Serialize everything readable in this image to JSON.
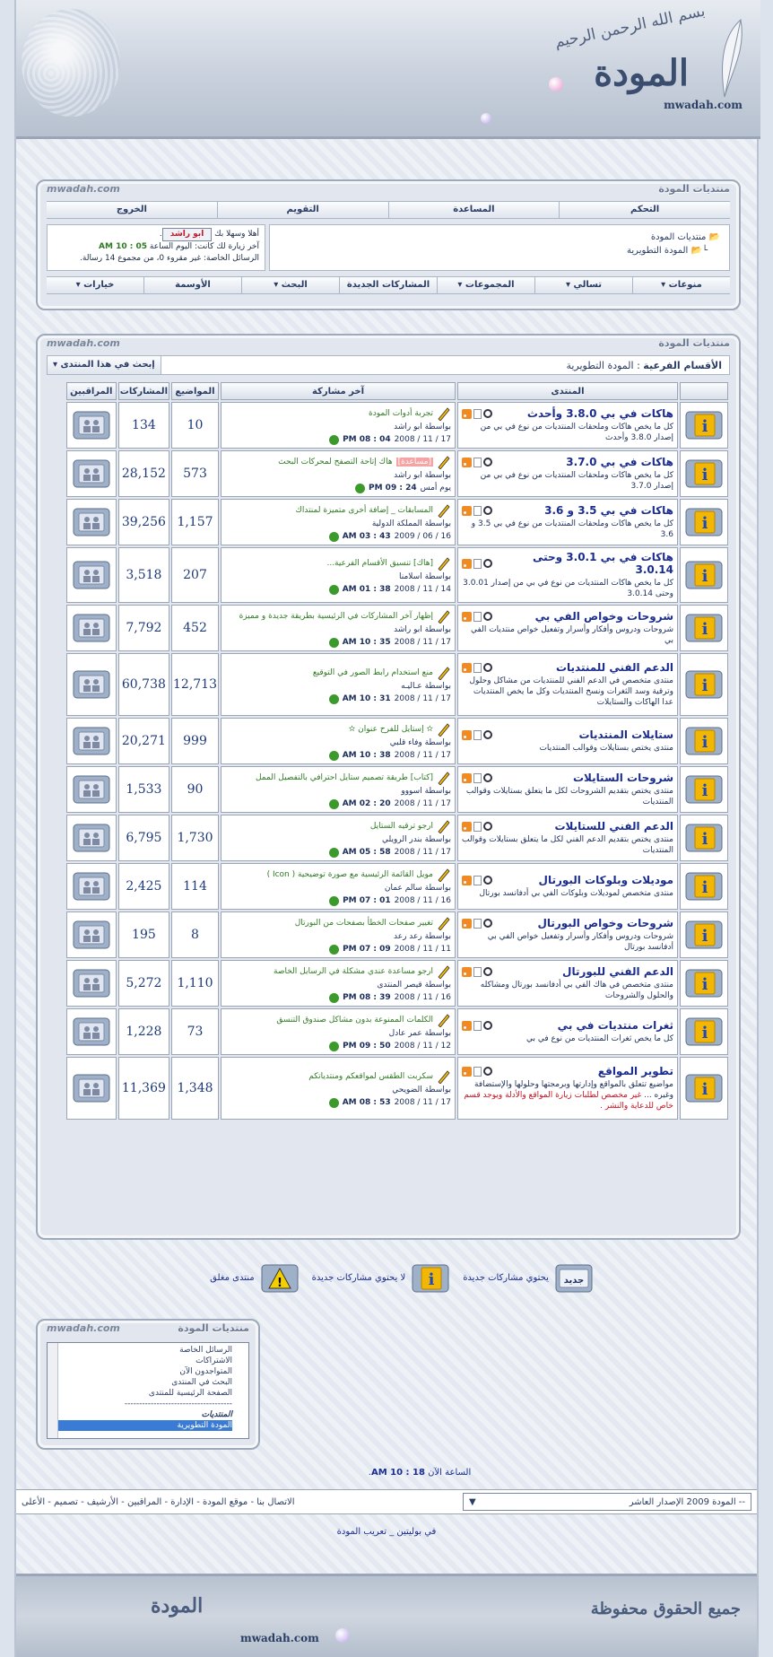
{
  "header": {
    "basmala": "بسم الله الرحمن الرحيم",
    "logo": "المودة",
    "url": "mwadah.com"
  },
  "colors": {
    "accent": "#1b2d8f",
    "panel": "#e2e7ef",
    "border": "#9ea9ba",
    "green": "#2c7b21",
    "red": "#c81020"
  },
  "top_panel": {
    "title_right": "منتديات المودة",
    "title_left": "mwadah.com",
    "nav_top": [
      "التحكم",
      "المساعدة",
      "التقويم",
      "الخروج"
    ],
    "tree": [
      "منتديات المودة",
      "المودة التطويرية"
    ],
    "user": {
      "greeting": "أهلا وسهلا بك",
      "username": "ابو راشد",
      "last_visit_label": "آخر زيارة لك كانت: اليوم الساعة",
      "last_visit_time": "05 : 10 AM",
      "pm_text": "الرسائل الخاصة: غير مقروء 0، من مجموع 14 رسالة."
    },
    "nav_bottom": [
      "منوعات ▾",
      "تسالي ▾",
      "المجموعات ▾",
      "المشاركات الجديدة",
      "البحث ▾",
      "الأوسمة",
      "خيارات ▾"
    ]
  },
  "forum_panel": {
    "title_right": "منتديات المودة",
    "title_left": "mwadah.com",
    "crumb_label": "الأقسام الفرعية",
    "crumb_value": "المودة التطويرية",
    "search_label": "إبحث في هذا المنتدى",
    "headers": {
      "forum": "المنتدى",
      "last": "آخر مشاركة",
      "topics": "المواضيع",
      "posts": "المشاركات",
      "mods": "المراقبين"
    },
    "rows": [
      {
        "title": "هاكات في بي 3.8.0 وأحدث",
        "desc": "كل ما يخص هاكات وملحقات المنتديات من نوع في بي من إصدار 3.8.0 وأحدث",
        "last_title": "تجربة أدوات المودة",
        "last_by": "بواسطة ابو راشد",
        "last_date": "2008 / 11 / 17",
        "last_time": "PM 08 : 04",
        "topics": "10",
        "posts": "134"
      },
      {
        "title": "هاكات في بي 3.7.0",
        "desc": "كل ما يخص هاكات وملحقات المنتديات من نوع في بي من إصدار 3.7.0",
        "last_tag": "[مساعدة]",
        "last_title": "هاك إتاحة التصفح لمحركات البحث",
        "last_by": "بواسطة ابو راشد",
        "last_date": "يوم أمس",
        "last_time": "PM 09 : 24",
        "topics": "573",
        "posts": "28,152"
      },
      {
        "title": "هاكات في بي 3.5 و 3.6",
        "desc": "كل ما يخص هاكات وملحقات المنتديات من نوع في بي 3.5 و 3.6",
        "last_title": "المسابقات _ إضافة أخرى متميزة لمنتداك",
        "last_by": "بواسطة المملكة الدولية",
        "last_date": "2009 / 06 / 16",
        "last_time": "AM 03 : 43",
        "topics": "1,157",
        "posts": "39,256"
      },
      {
        "title": "هاكات في بي 3.0.1 وحتى 3.0.14",
        "desc": "كل ما يخص هاكات المنتديات من نوع في بي من إصدار 3.0.01 وحتى 3.0.14",
        "last_title": "[هاك] تنسيق الأقسام الفرعية...",
        "last_by": "بواسطة اسلامنا",
        "last_date": "2008 / 11 / 14",
        "last_time": "AM 01 : 38",
        "topics": "207",
        "posts": "3,518"
      },
      {
        "title": "شروحات وخواص الفي بي",
        "desc": "شروحات ودروس وأفكار وأسرار وتفعيل خواص منتديات الفي بي",
        "last_title": "إظهار آخر المشاركات في الرئيسية بطريقة جديدة و مميزة",
        "last_by": "بواسطة ابو راشد",
        "last_date": "2008 / 11 / 17",
        "last_time": "AM 10 : 35",
        "topics": "452",
        "posts": "7,792"
      },
      {
        "title": "الدعم الفني للمنتديات",
        "desc": "منتدى متخصص في الدعم الفني للمنتديات من مشاكل وحلول وترقية وسد الثغرات ونسخ المنتديات وكل ما يخص المنتديات عدا الهاكات والستايلات",
        "last_title": "منع استخدام رابط الصور في التوقيع",
        "last_by": "بواسطة عـاليـه",
        "last_date": "2008 / 11 / 17",
        "last_time": "AM 10 : 31",
        "topics": "12,713",
        "posts": "60,738"
      },
      {
        "title": "ستايلات المنتديات",
        "desc": "منتدى يختص بستايلات وقوالب المنتديات",
        "last_title": "✫ إستايل للفرح عنوان ✫",
        "last_by": "بواسطة وفاء قلبي",
        "last_date": "2008 / 11 / 17",
        "last_time": "AM 10 : 38",
        "topics": "999",
        "posts": "20,271"
      },
      {
        "title": "شروحات الستايلات",
        "desc": "منتدى يختص بتقديم الشروحات لكل ما يتعلق بستايلات وقوالب المنتديات",
        "last_title": "[كتاب] طريقة تصميم ستايل احترافي بالتفصيل الممل",
        "last_by": "بواسطة اسووو",
        "last_date": "2008 / 11 / 17",
        "last_time": "AM 02 : 20",
        "topics": "90",
        "posts": "1,533"
      },
      {
        "title": "الدعم الفني للستايلات",
        "desc": "منتدى يختص بتقديم الدعم الفني لكل ما يتعلق بستايلات وقوالب المنتديات",
        "last_title": "ارجو ترقيه الستايل",
        "last_by": "بواسطة بندر الرويلي",
        "last_date": "2008 / 11 / 17",
        "last_time": "AM 05 : 58",
        "topics": "1,730",
        "posts": "6,795"
      },
      {
        "title": "موديلات وبلوكات البورتال",
        "desc": "منتدى متخصص لموديلات وبلوكات الفي بي أدفانسد بورتال",
        "last_title": "مويل القائمة الرئيسية مع صورة توضيحية ( Icon )",
        "last_by": "بواسطة سالم عمان",
        "last_date": "2008 / 11 / 16",
        "last_time": "PM 07 : 01",
        "topics": "114",
        "posts": "2,425"
      },
      {
        "title": "شروحات وخواص البورتال",
        "desc": "شروحات ودروس وأفكار وأسرار وتفعيل خواص الفي بي أدفانسد بورتال",
        "last_title": "تغيير صفحات الخطأ بصفحات من البورتال",
        "last_by": "بواسطة رعد رعد",
        "last_date": "2008 / 11 / 11",
        "last_time": "PM 07 : 09",
        "topics": "8",
        "posts": "195"
      },
      {
        "title": "الدعم الفني للبورتال",
        "desc": "منتدى متخصص في هاك الفي بي أدفانسد بورتال ومشاكله والحلول والشروحات",
        "last_title": "ارجو مساعدة عندي مشكلة في الرسايل الخاصة",
        "last_by": "بواسطة قيصر المنتدى",
        "last_date": "2008 / 11 / 16",
        "last_time": "PM 08 : 39",
        "topics": "1,110",
        "posts": "5,272"
      },
      {
        "title": "ثغرات منتديات في بي",
        "desc": "كل ما يخص ثغرات المنتديات من نوع في بي",
        "last_title": "الكلمات الممنوعة بدون مشاكل صندوق التنسق",
        "last_by": "بواسطة عمر عادل",
        "last_date": "2008 / 11 / 12",
        "last_time": "PM 09 : 50",
        "topics": "73",
        "posts": "1,228"
      },
      {
        "title": "تطوير المواقع",
        "desc": "مواضيع تتعلق بالمواقع وإدارتها وبرمجتها وحلولها والإستضافة وغيره ...",
        "desc_red": "غير مخصص لطلبات زيارة المواقع والأدلة ويوجد قسم خاص للدعاية والنشر .",
        "last_title": "سكربت الطقس لمواقعكم ومنتدياتكم",
        "last_by": "بواسطة الضويحي",
        "last_date": "2008 / 11 / 17",
        "last_time": "AM 08 : 53",
        "topics": "1,348",
        "posts": "11,369"
      }
    ]
  },
  "legend": {
    "new_badge": "جديد",
    "new": "يحتوي مشاركات جديدة",
    "no_new": "لا يحتوي مشاركات جديدة",
    "closed": "منتدى مغلق"
  },
  "quick_nav": {
    "title_right": "منتديات المودة",
    "title_left": "mwadah.com",
    "items": [
      "الرسائل الخاصة",
      "الاشتراكات",
      "المتواجدون الآن",
      "البحث في المنتدى",
      "الصفحة الرئيسية للمنتدى",
      "-------------------------------------",
      "المنتديات",
      "المودة التطويرية"
    ]
  },
  "footer": {
    "time_label": "الساعة الآن",
    "time": "AM 10 : 18",
    "style_select": "-- المودة 2009 الإصدار العاشر",
    "links": "الاتصال بنا - موقع المودة - الإدارة - المراقبين - الأرشيف - تصميم - الأعلى",
    "credit": "في بوليتين _ تعريب المودة",
    "rights": "جميع الحقوق محفوظة",
    "logo": "المودة",
    "url": "mwadah.com"
  }
}
